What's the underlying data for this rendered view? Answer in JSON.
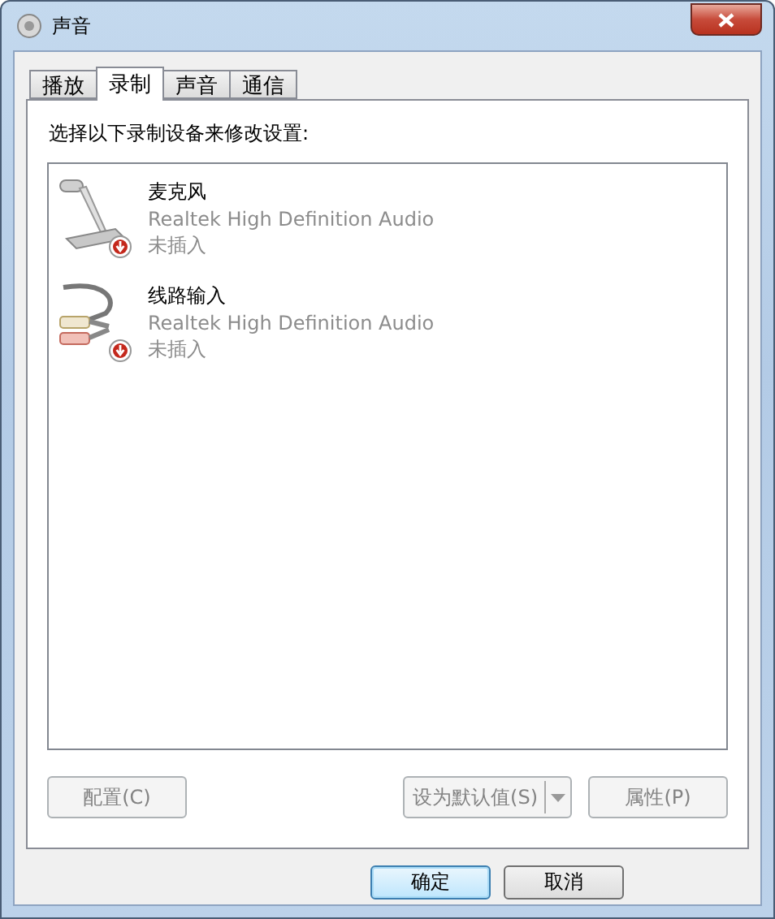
{
  "window": {
    "title": "声音"
  },
  "tabs": [
    {
      "label": "播放",
      "selected": false
    },
    {
      "label": "录制",
      "selected": true
    },
    {
      "label": "声音",
      "selected": false
    },
    {
      "label": "通信",
      "selected": false
    }
  ],
  "instruction": "选择以下录制设备来修改设置:",
  "devices": [
    {
      "kind": "microphone",
      "name": "麦克风",
      "driver": "Realtek High Definition Audio",
      "status": "未插入",
      "unplugged": true
    },
    {
      "kind": "line-in",
      "name": "线路输入",
      "driver": "Realtek High Definition Audio",
      "status": "未插入",
      "unplugged": true
    }
  ],
  "panel_buttons": [
    {
      "kind": "plain",
      "label": "配置(C)",
      "disabled": true
    },
    {
      "kind": "split",
      "label": "设为默认值(S)",
      "disabled": true
    },
    {
      "kind": "plain",
      "label": "属性(P)",
      "disabled": true
    }
  ],
  "dialog_buttons": [
    {
      "label": "确定",
      "default": true
    },
    {
      "label": "取消",
      "default": false
    }
  ]
}
